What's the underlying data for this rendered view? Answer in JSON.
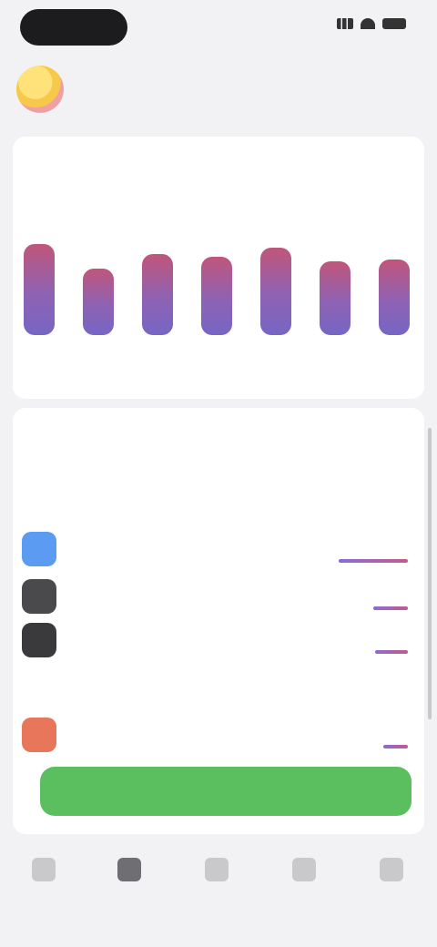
{
  "colors": {
    "accent_gradient_top": "#c0567a",
    "accent_gradient_bottom": "#7666c4",
    "cta_green": "#5cbf5f",
    "background": "#f2f2f4"
  },
  "header": {
    "title": "",
    "action": ""
  },
  "chart_card": {
    "title": "",
    "subtitle": ""
  },
  "chart_data": {
    "type": "bar",
    "categories": [
      "",
      "",
      "",
      "",
      "",
      "",
      ""
    ],
    "values": [
      100,
      73,
      89,
      86,
      96,
      81,
      83
    ],
    "title": "",
    "xlabel": "",
    "ylabel": ""
  },
  "apps_card": {
    "title": "",
    "subtitle": "",
    "section_one": "",
    "section_two": "",
    "apps": [
      {
        "name": "",
        "time": "",
        "icon": "app-icon-blue",
        "color": "#5b9cf2",
        "usage": 1.0
      },
      {
        "name": "",
        "time": "",
        "icon": "app-icon-dark",
        "color": "#4a4a4c",
        "usage": 0.5
      },
      {
        "name": "",
        "time": "",
        "icon": "app-icon-dark",
        "color": "#3a3a3c",
        "usage": 0.47
      },
      {
        "name": "",
        "time": "",
        "icon": "app-icon-orange",
        "color": "#e8765a",
        "usage": 0.35
      }
    ]
  },
  "cta": {
    "label": "",
    "note": ""
  },
  "tabs": [
    {
      "label": "",
      "icon": "tab-icon"
    },
    {
      "label": "",
      "icon": "tab-icon"
    },
    {
      "label": "",
      "icon": "tab-icon"
    },
    {
      "label": "",
      "icon": "tab-icon"
    },
    {
      "label": "",
      "icon": "tab-icon"
    }
  ],
  "active_tab": 1
}
